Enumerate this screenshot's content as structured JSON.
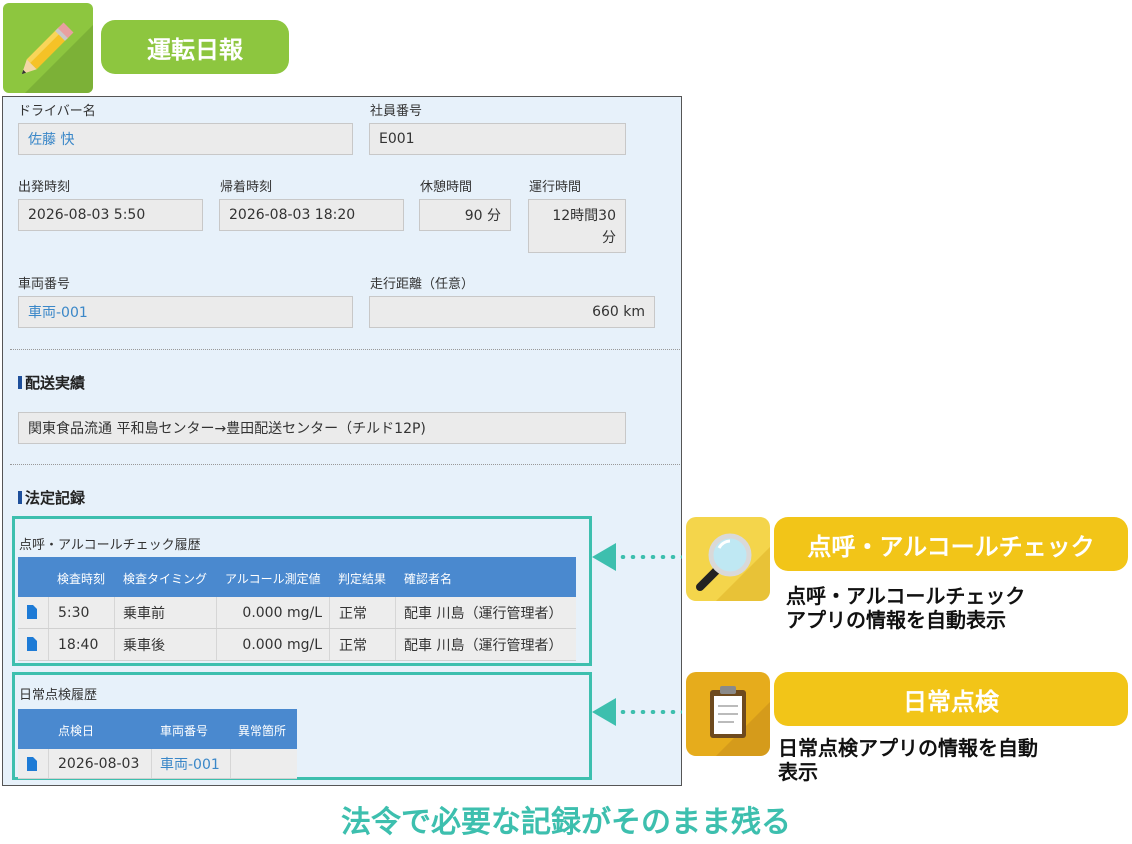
{
  "app": {
    "title": "運転日報",
    "icon": "pencil-icon",
    "accent": "#8dc63f"
  },
  "form": {
    "driver_label": "ドライバー名",
    "driver_value": "佐藤 快",
    "employee_label": "社員番号",
    "employee_value": "E001",
    "departure_label": "出発時刻",
    "departure_value": "2026-08-03 5:50",
    "return_label": "帰着時刻",
    "return_value": "2026-08-03 18:20",
    "break_label": "休憩時間",
    "break_value": "90 分",
    "operation_label": "運行時間",
    "operation_value_line1": "12時間30",
    "operation_value_line2": "分",
    "vehicle_label": "車両番号",
    "vehicle_value": "車両-001",
    "distance_label": "走行距離（任意）",
    "distance_value": "660 km"
  },
  "delivery": {
    "title": "配送実績",
    "value": "関東食品流通 平和島センター→豊田配送センター（チルド12P)"
  },
  "legal": {
    "title": "法定記録"
  },
  "alcohol": {
    "title": "点呼・アルコールチェック履歴",
    "columns": [
      "検査時刻",
      "検査タイミング",
      "アルコール測定値",
      "判定結果",
      "確認者名"
    ],
    "rows": [
      [
        "5:30",
        "乗車前",
        "0.000 mg/L",
        "正常",
        "配車 川島（運行管理者）"
      ],
      [
        "18:40",
        "乗車後",
        "0.000 mg/L",
        "正常",
        "配車 川島（運行管理者）"
      ]
    ]
  },
  "inspection": {
    "title": "日常点検履歴",
    "columns": [
      "点検日",
      "車両番号",
      "異常箇所"
    ],
    "rows": [
      [
        "2026-08-03",
        "車両-001",
        ""
      ]
    ]
  },
  "callouts": [
    {
      "icon": "magnifier-icon",
      "title": "点呼・アルコールチェック",
      "desc_line1": "点呼・アルコールチェック",
      "desc_line2": "アプリの情報を自動表示"
    },
    {
      "icon": "clipboard-icon",
      "title": "日常点検",
      "desc_line1": "日常点検アプリの情報を自動",
      "desc_line2": "表示"
    }
  ],
  "caption": "法令で必要な記録がそのまま残る",
  "colors": {
    "teal": "#3dbfae",
    "yellow": "#f2c518",
    "table_header": "#4a89cf",
    "link": "#3a87c8"
  }
}
